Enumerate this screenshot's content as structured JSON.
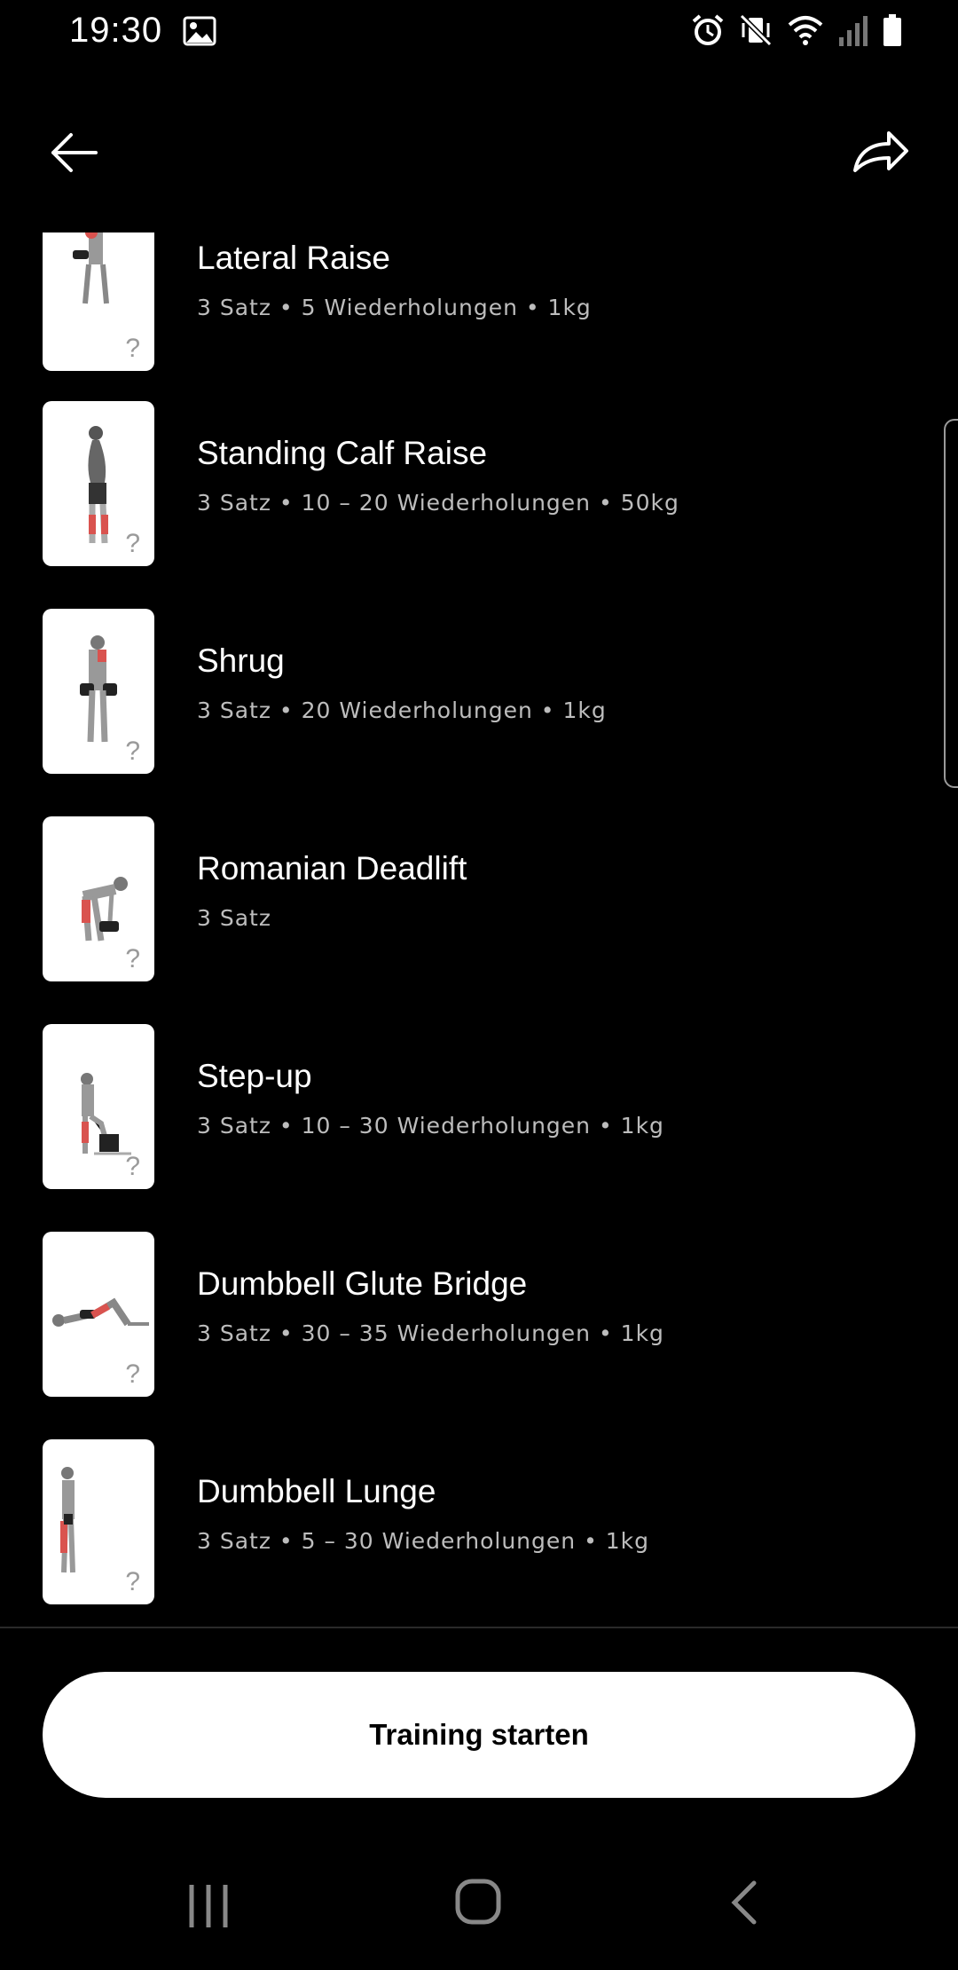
{
  "status": {
    "time": "19:30",
    "icons": [
      "gallery-icon",
      "alarm-icon",
      "vibrate-mute-icon",
      "wifi-icon",
      "signal-icon",
      "battery-icon"
    ]
  },
  "appbar": {
    "back_icon": "arrow-left-icon",
    "share_icon": "share-icon"
  },
  "exercises": [
    {
      "name": "Lateral Raise",
      "detail": "3 Satz • 5 Wiederholungen • 1kg",
      "help": "?"
    },
    {
      "name": "Standing Calf Raise",
      "detail": "3 Satz • 10 – 20 Wiederholungen • 50kg",
      "help": "?"
    },
    {
      "name": "Shrug",
      "detail": "3 Satz • 20 Wiederholungen • 1kg",
      "help": "?"
    },
    {
      "name": "Romanian Deadlift",
      "detail": "3 Satz",
      "help": "?"
    },
    {
      "name": "Step-up",
      "detail": "3 Satz • 10 – 30 Wiederholungen • 1kg",
      "help": "?"
    },
    {
      "name": "Dumbbell Glute Bridge",
      "detail": "3 Satz • 30 – 35 Wiederholungen • 1kg",
      "help": "?"
    },
    {
      "name": "Dumbbell Lunge",
      "detail": "3 Satz • 5 – 30 Wiederholungen • 1kg",
      "help": "?"
    }
  ],
  "cta": {
    "label": "Training starten"
  },
  "colors": {
    "background": "#000000",
    "button": "#ffffff",
    "muscle_highlight": "#d9534f"
  }
}
